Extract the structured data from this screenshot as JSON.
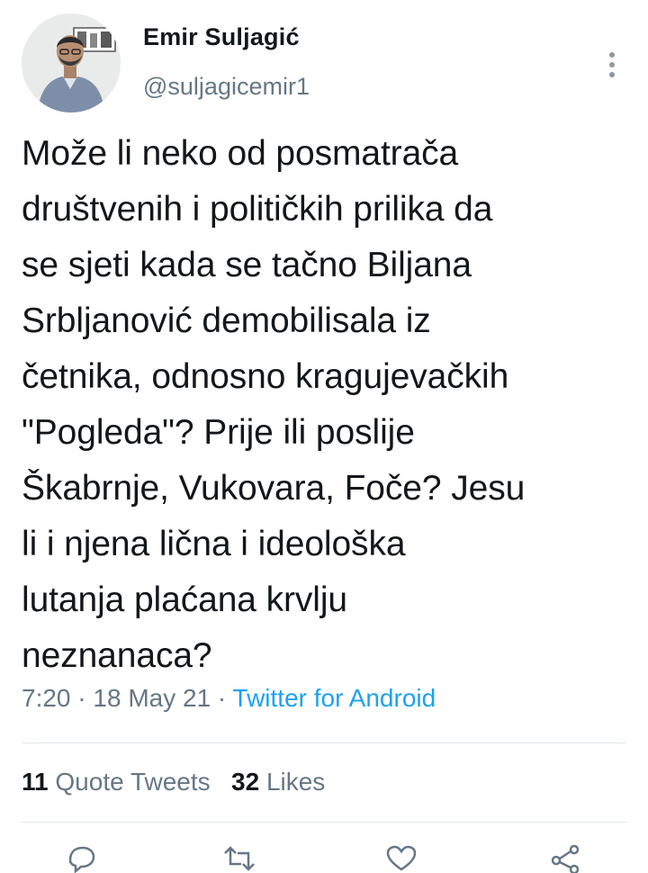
{
  "author": {
    "display_name": "Emir Suljagić",
    "handle": "@suljagicemir1"
  },
  "tweet": {
    "text": "Može li neko od posmatrača\ndruštvenih i političkih prilika da\nse sjeti kada se tačno Biljana\nSrbljanović demobilisala iz\nčetnika, odnosno kragujevačkih\n\"Pogleda\"? Prije ili poslije\nŠkabrnje, Vukovara, Foče? Jesu\nli i njena lična i ideološka\nlutanja plaćana krvlju\nneznanaca?"
  },
  "meta": {
    "time": "7:20",
    "separator": " · ",
    "date": "18 May 21",
    "source": "Twitter for Android"
  },
  "stats": {
    "quote_count": "11",
    "quote_label": "Quote Tweets",
    "like_count": "32",
    "like_label": "Likes"
  },
  "icons": {
    "more": "more-vertical-icon",
    "reply": "reply-icon",
    "retweet": "retweet-icon",
    "like": "heart-icon",
    "share": "share-icon"
  },
  "colors": {
    "text": "#14171a",
    "secondary": "#657786",
    "link": "#1da1f2",
    "divider": "#e1e8ed"
  }
}
